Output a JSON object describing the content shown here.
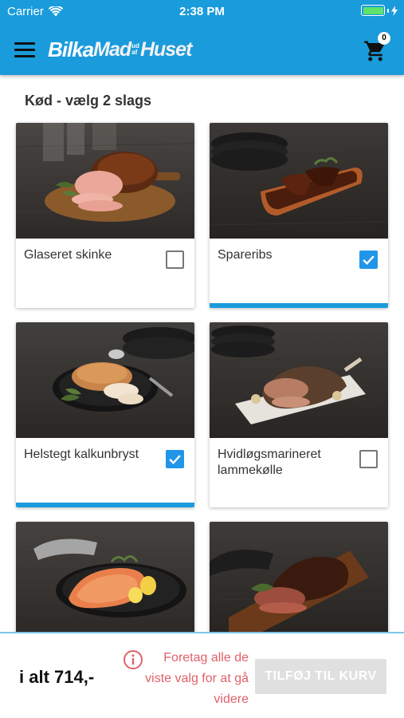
{
  "status": {
    "carrier": "Carrier",
    "time": "2:38 PM"
  },
  "header": {
    "logo": {
      "part1": "Bilka",
      "part2": "Mad",
      "small_top": "ud",
      "small_bottom": "af",
      "part3": "Huset"
    },
    "cart_count": "0",
    "bar_color": "#1a9bdb"
  },
  "section": {
    "title": "Kød - vælg 2 slags"
  },
  "products": [
    {
      "label": "Glaseret skinke",
      "checked": false,
      "icon": "ham-photo"
    },
    {
      "label": "Spareribs",
      "checked": true,
      "icon": "spareribs-photo"
    },
    {
      "label": "Helstegt kalkunbryst",
      "checked": true,
      "icon": "turkey-breast-photo"
    },
    {
      "label": "Hvidløgsmarineret lammekølle",
      "checked": false,
      "icon": "lamb-leg-photo"
    },
    {
      "label": "",
      "checked": false,
      "icon": "salmon-photo"
    },
    {
      "label": "",
      "checked": false,
      "icon": "roast-beef-photo"
    }
  ],
  "footer": {
    "total": "i alt 714,-",
    "info": "Foretag alle de viste valg for at gå videre",
    "add_button": "TILFØJ TIL KURV",
    "warning_color": "#e06069",
    "accent": "#2196e9"
  }
}
